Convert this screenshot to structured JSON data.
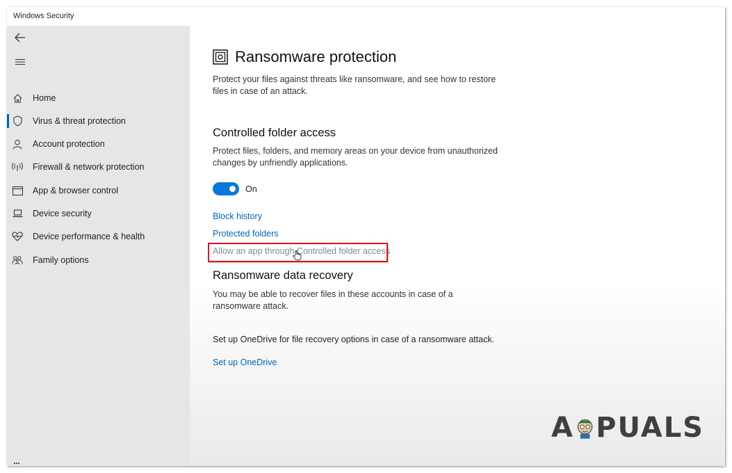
{
  "window": {
    "title": "Windows Security"
  },
  "sidebar": {
    "back_icon": "back-arrow-icon",
    "menu_icon": "hamburger-menu-icon",
    "items": [
      {
        "label": "Home",
        "icon": "home-icon",
        "active": false
      },
      {
        "label": "Virus & threat protection",
        "icon": "shield-icon",
        "active": true
      },
      {
        "label": "Account protection",
        "icon": "person-icon",
        "active": false
      },
      {
        "label": "Firewall & network protection",
        "icon": "wireless-antenna-icon",
        "active": false
      },
      {
        "label": "App & browser control",
        "icon": "browser-window-icon",
        "active": false
      },
      {
        "label": "Device security",
        "icon": "laptop-icon",
        "active": false
      },
      {
        "label": "Device performance & health",
        "icon": "heart-pulse-icon",
        "active": false
      },
      {
        "label": "Family options",
        "icon": "family-icon",
        "active": false
      }
    ]
  },
  "main": {
    "title": "Ransomware protection",
    "title_icon": "ransomware-vault-icon",
    "description": "Protect your files against threats like ransomware, and see how to restore files in case of an attack.",
    "cfa": {
      "heading": "Controlled folder access",
      "description": "Protect files, folders, and memory areas on your device from unauthorized changes by unfriendly applications.",
      "toggle_state": "On",
      "links": {
        "block_history": "Block history",
        "protected_folders": "Protected folders",
        "allow_app": "Allow an app through Controlled folder access"
      }
    },
    "recovery": {
      "heading": "Ransomware data recovery",
      "description": "You may be able to recover files in these accounts in case of a ransomware attack.",
      "onedrive_text": "Set up OneDrive for file recovery options in case of a ransomware attack.",
      "onedrive_link": "Set up OneDrive"
    }
  },
  "watermark": {
    "text_left": "A",
    "text_right": "PUALS"
  },
  "colors": {
    "accent": "#0063b1",
    "toggle_on": "#0a78d7",
    "highlight": "#d9151d",
    "sidebar_bg": "#e6e6e6"
  }
}
